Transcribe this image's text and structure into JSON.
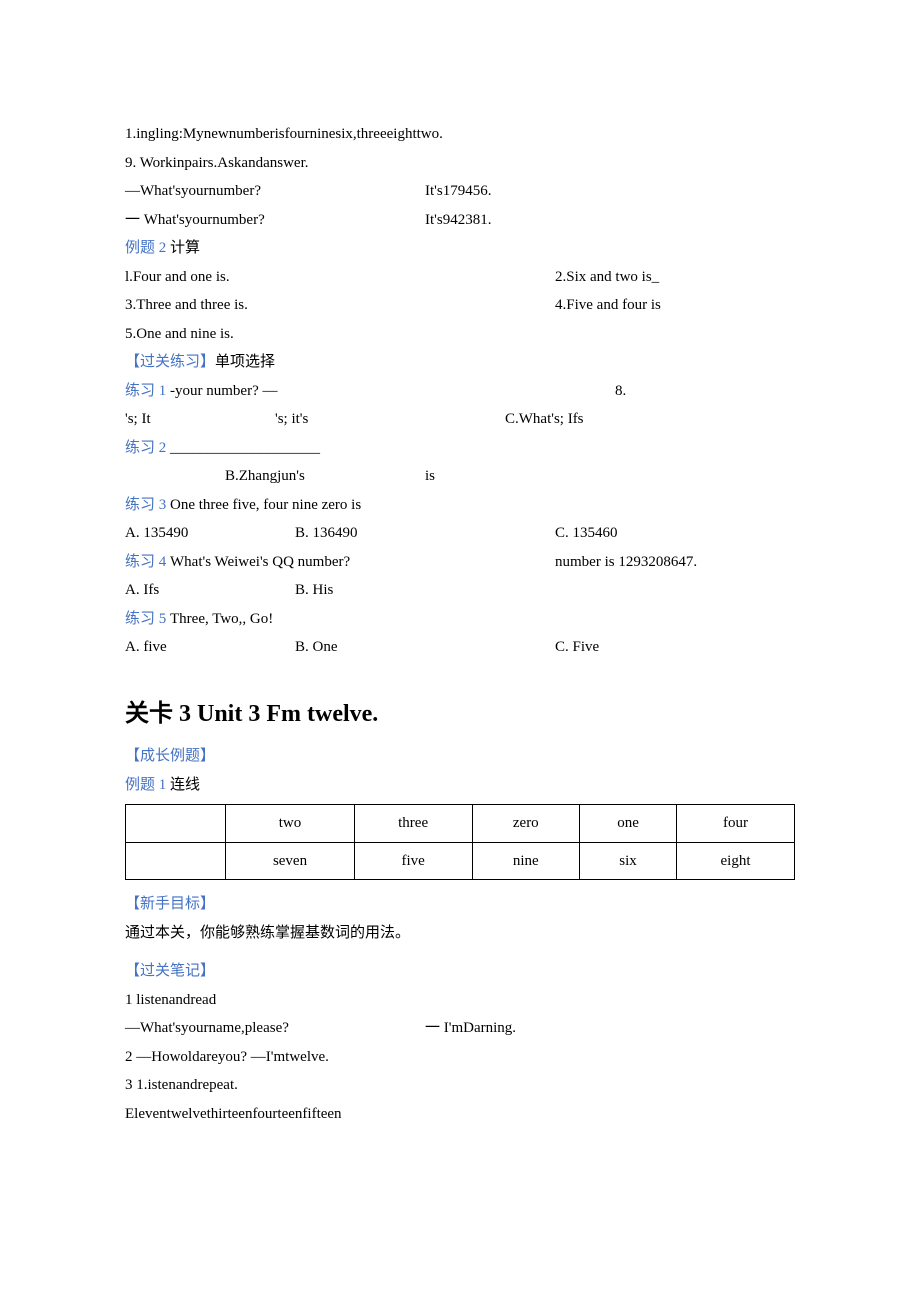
{
  "top": {
    "line1": "1.ingling:Mynewnumberisfourninesix,threeeighttwo.",
    "line2": "9.    Workinpairs.Askandanswer.",
    "q1_left": "—What'syournumber?",
    "q1_right": "It's179456.",
    "q2_left": "一 What'syournumber?",
    "q2_right": "It's942381."
  },
  "ex2": {
    "label": "例题 2 ",
    "title": "计算",
    "i1": "l.Four and one is.",
    "i2": "2.Six and two is_",
    "i3": "3.Three and three is.",
    "i4": "4.Five and four is",
    "i5": "5.One and nine is."
  },
  "pass": {
    "label": "【过关练习】",
    "title": "单项选择"
  },
  "p1": {
    "label": "练习  1 ",
    "text": "-your number? —",
    "right": "8.",
    "optA": "'s; It",
    "optB": "'s; it's",
    "optC": "C.What's; Ifs"
  },
  "p2": {
    "label": "练习 2 ",
    "line": "____________________",
    "optB": "B.Zhangjun's",
    "mid": "is"
  },
  "p3": {
    "label": "练习  3 ",
    "text": "One three five, four nine zero is",
    "optA": "A. 135490",
    "optB": "B. 136490",
    "optC": "C. 135460"
  },
  "p4": {
    "label": "练习  4 ",
    "text": "What's Weiwei's QQ number?",
    "right": "number is 1293208647.",
    "optA": "A. Ifs",
    "optB": "B. His"
  },
  "p5": {
    "label": "练习  5 ",
    "text": "Three, Two,, Go!",
    "optA": "A. five",
    "optB": "B. One",
    "optC": "C. Five"
  },
  "section3": {
    "heading": "关卡 3 Unit 3 Fm twelve.",
    "growth": "【成长例题】",
    "ex1_label": "例题 1 ",
    "ex1_title": "连线"
  },
  "table": {
    "r1": [
      "",
      "two",
      "three",
      "zero",
      "one",
      "four"
    ],
    "r2": [
      "",
      "seven",
      "five",
      "nine",
      "six",
      "eight"
    ]
  },
  "novice": {
    "label": "【新手目标】",
    "text": "通过本关，你能够熟练掌握基数词的用法。"
  },
  "notes": {
    "label": "【过关笔记】",
    "n1": "1    listenandread",
    "n1a": "—What'syourname,please?",
    "n1b": "一 I'mDarning.",
    "n2": "2    —Howoldareyou?       —I'mtwelve.",
    "n3": "3    1.istenandrepeat.",
    "n4": "Eleventwelvethirteenfourteenfifteen"
  }
}
